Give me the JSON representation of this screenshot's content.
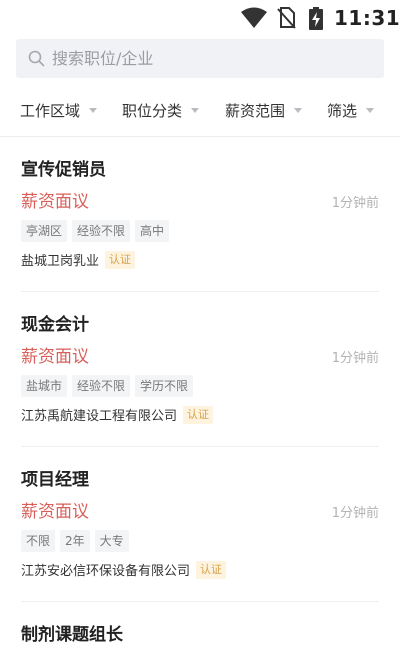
{
  "status_bar": {
    "time": "11:31",
    "icons": [
      "wifi-icon",
      "no-sim-icon",
      "battery-charging-icon"
    ]
  },
  "search": {
    "placeholder": "搜索职位/企业",
    "value": ""
  },
  "filters": [
    {
      "label": "工作区域"
    },
    {
      "label": "职位分类"
    },
    {
      "label": "薪资范围"
    },
    {
      "label": "筛选"
    }
  ],
  "jobs": [
    {
      "title": "宣传促销员",
      "salary": "薪资面议",
      "time": "1分钟前",
      "tags": [
        "亭湖区",
        "经验不限",
        "高中"
      ],
      "company": "盐城卫岗乳业",
      "badge": "认证"
    },
    {
      "title": "现金会计",
      "salary": "薪资面议",
      "time": "1分钟前",
      "tags": [
        "盐城市",
        "经验不限",
        "学历不限"
      ],
      "company": "江苏禹航建设工程有限公司",
      "badge": "认证"
    },
    {
      "title": "项目经理",
      "salary": "薪资面议",
      "time": "1分钟前",
      "tags": [
        "不限",
        "2年",
        "大专"
      ],
      "company": "江苏安必信环保设备有限公司",
      "badge": "认证"
    },
    {
      "title": "制剂课题组长"
    }
  ],
  "colors": {
    "salary": "#d9605a",
    "badge_bg": "#fdf3de",
    "badge_text": "#d7a24a",
    "search_bg": "#f1f2f6"
  }
}
